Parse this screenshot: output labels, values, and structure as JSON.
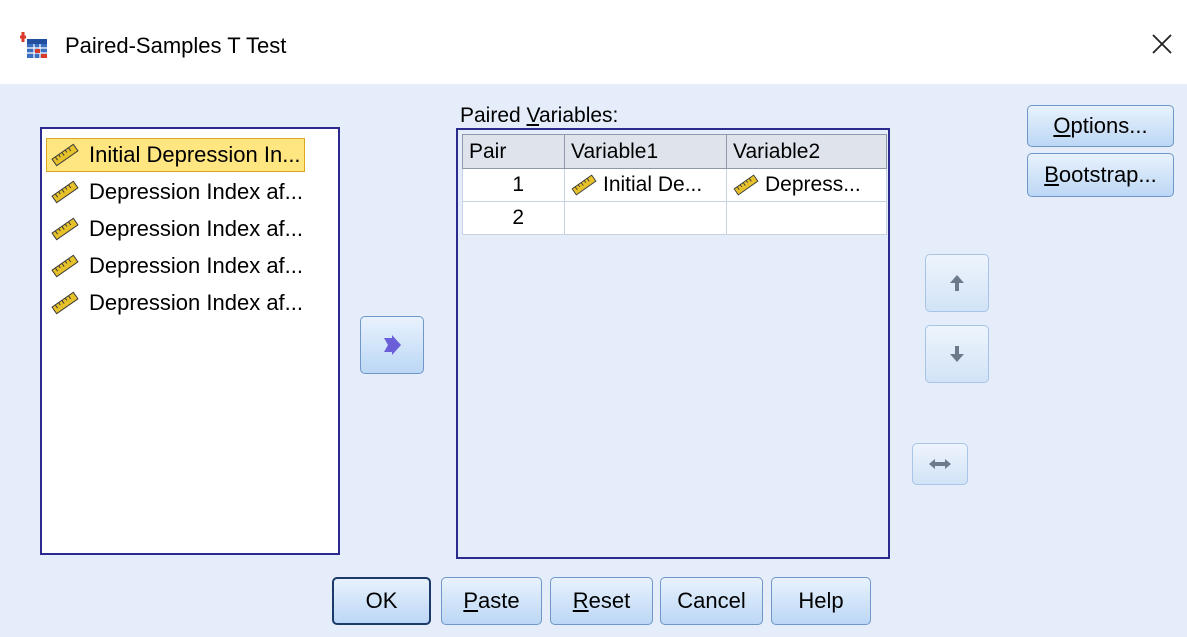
{
  "window": {
    "title": "Paired-Samples T Test",
    "app_icon": "spss-table-icon",
    "close_icon": "close-x-icon"
  },
  "source_list": {
    "items": [
      {
        "label": "Initial Depression In...",
        "icon": "scale-ruler-icon",
        "selected": true
      },
      {
        "label": "Depression Index af...",
        "icon": "scale-ruler-icon",
        "selected": false
      },
      {
        "label": "Depression Index af...",
        "icon": "scale-ruler-icon",
        "selected": false
      },
      {
        "label": "Depression Index af...",
        "icon": "scale-ruler-icon",
        "selected": false
      },
      {
        "label": "Depression Index af...",
        "icon": "scale-ruler-icon",
        "selected": false
      }
    ]
  },
  "paired_variables": {
    "label_prefix": "Paired ",
    "label_underlined": "V",
    "label_suffix": "ariables:",
    "columns": [
      "Pair",
      "Variable1",
      "Variable2"
    ],
    "rows": [
      {
        "pair": "1",
        "variable1": "Initial De...",
        "variable2": "Depress..."
      },
      {
        "pair": "2",
        "variable1": "",
        "variable2": ""
      }
    ]
  },
  "side_buttons": {
    "options_u": "O",
    "options_rest": "ptions...",
    "bootstrap_u": "B",
    "bootstrap_rest": "ootstrap..."
  },
  "footer_buttons": {
    "ok": "OK",
    "paste_u": "P",
    "paste_rest": "aste",
    "reset_u": "R",
    "reset_rest": "eset",
    "cancel": "Cancel",
    "help": "Help"
  },
  "colors": {
    "dialog_bg": "#e4edf9",
    "list_border": "#2b2b8f",
    "selected_bg": "#ffe680",
    "arrow_active": "#6a5fd8",
    "arrow_disabled": "#6c7a8c"
  }
}
